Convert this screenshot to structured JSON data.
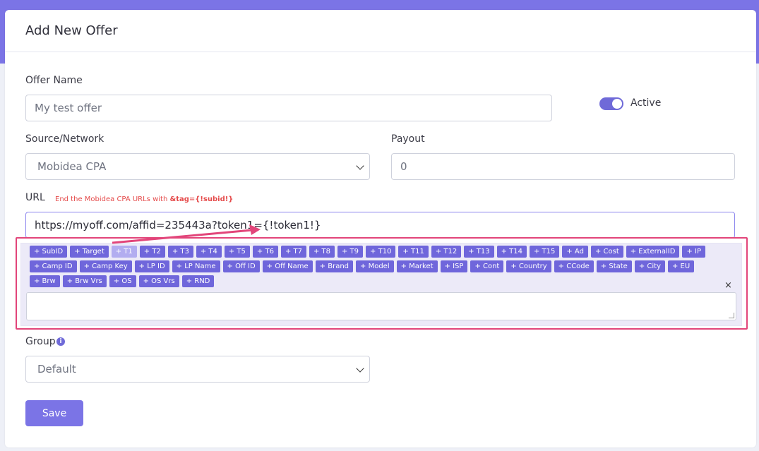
{
  "header": {
    "title": "Add New Offer"
  },
  "form": {
    "offer_name": {
      "label": "Offer Name",
      "value": "My test offer"
    },
    "active": {
      "label": "Active",
      "on": true
    },
    "source": {
      "label": "Source/Network",
      "value": "Mobidea CPA"
    },
    "payout": {
      "label": "Payout",
      "value": "0"
    },
    "url": {
      "label": "URL",
      "hint_prefix": "End the Mobidea CPA URLs with ",
      "hint_code": "&tag={!subid!}",
      "value": "https://myoff.com/affid=235443a?token1={!token1!}"
    },
    "tokens": [
      "+ SubID",
      "+ Target",
      "+ T1",
      "+ T2",
      "+ T3",
      "+ T4",
      "+ T5",
      "+ T6",
      "+ T7",
      "+ T8",
      "+ T9",
      "+ T10",
      "+ T11",
      "+ T12",
      "+ T13",
      "+ T14",
      "+ T15",
      "+ Ad",
      "+ Cost",
      "+ ExternalID",
      "+ IP",
      "+ Camp ID",
      "+ Camp Key",
      "+ LP ID",
      "+ LP Name",
      "+ Off ID",
      "+ Off Name",
      "+ Brand",
      "+ Model",
      "+ Market",
      "+ ISP",
      "+ Cont",
      "+ Country",
      "+ CCode",
      "+ State",
      "+ City",
      "+ EU",
      "+ Brw",
      "+ Brw Vrs",
      "+ OS",
      "+ OS Vrs",
      "+ RND"
    ],
    "faded_token_index": 2,
    "close_label": "×",
    "group": {
      "label": "Group",
      "value": "Default",
      "info_glyph": "i"
    },
    "save_label": "Save"
  },
  "colors": {
    "accent": "#7b74e6",
    "highlight": "#e2457a",
    "hint": "#e54b4b"
  }
}
